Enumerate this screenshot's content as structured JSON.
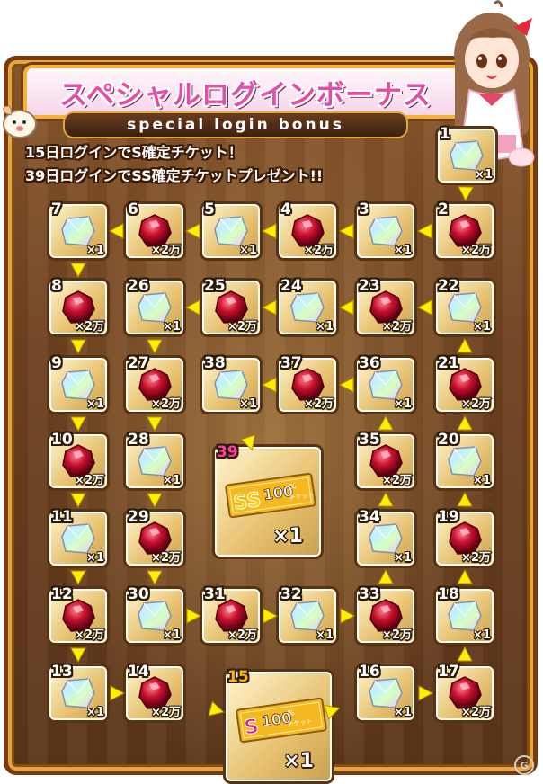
{
  "title": "スペシャルログインボーナス",
  "subtitle": "special login bonus",
  "description_line1": "15日ログインでS確定チケット！",
  "description_line2": "39日ログインでSS確定チケットプレゼント!!",
  "tiles": [
    {
      "day": "1",
      "reward": "crystal",
      "qty": "×1"
    },
    {
      "day": "2",
      "reward": "ruby",
      "qty": "×2万"
    },
    {
      "day": "3",
      "reward": "crystal",
      "qty": "×1"
    },
    {
      "day": "4",
      "reward": "ruby",
      "qty": "×2万"
    },
    {
      "day": "5",
      "reward": "crystal",
      "qty": "×1"
    },
    {
      "day": "6",
      "reward": "ruby",
      "qty": "×2万"
    },
    {
      "day": "7",
      "reward": "crystal",
      "qty": "×1"
    },
    {
      "day": "8",
      "reward": "ruby",
      "qty": "×2万"
    },
    {
      "day": "9",
      "reward": "crystal",
      "qty": "×1"
    },
    {
      "day": "10",
      "reward": "ruby",
      "qty": "×2万"
    },
    {
      "day": "11",
      "reward": "crystal",
      "qty": "×1"
    },
    {
      "day": "12",
      "reward": "ruby",
      "qty": "×2万"
    },
    {
      "day": "13",
      "reward": "crystal",
      "qty": "×1"
    },
    {
      "day": "14",
      "reward": "ruby",
      "qty": "×2万"
    },
    {
      "day": "15",
      "reward": "s-ticket",
      "qty": "×1"
    },
    {
      "day": "16",
      "reward": "crystal",
      "qty": "×1"
    },
    {
      "day": "17",
      "reward": "ruby",
      "qty": "×2万"
    },
    {
      "day": "18",
      "reward": "crystal",
      "qty": "×1"
    },
    {
      "day": "19",
      "reward": "ruby",
      "qty": "×2万"
    },
    {
      "day": "20",
      "reward": "crystal",
      "qty": "×1"
    },
    {
      "day": "21",
      "reward": "ruby",
      "qty": "×2万"
    },
    {
      "day": "22",
      "reward": "crystal",
      "qty": "×1"
    },
    {
      "day": "23",
      "reward": "ruby",
      "qty": "×2万"
    },
    {
      "day": "24",
      "reward": "crystal",
      "qty": "×1"
    },
    {
      "day": "25",
      "reward": "ruby",
      "qty": "×2万"
    },
    {
      "day": "26",
      "reward": "crystal",
      "qty": "×1"
    },
    {
      "day": "27",
      "reward": "ruby",
      "qty": "×2万"
    },
    {
      "day": "28",
      "reward": "crystal",
      "qty": "×1"
    },
    {
      "day": "29",
      "reward": "ruby",
      "qty": "×2万"
    },
    {
      "day": "30",
      "reward": "crystal",
      "qty": "×1"
    },
    {
      "day": "31",
      "reward": "ruby",
      "qty": "×2万"
    },
    {
      "day": "32",
      "reward": "crystal",
      "qty": "×1"
    },
    {
      "day": "33",
      "reward": "ruby",
      "qty": "×2万"
    },
    {
      "day": "34",
      "reward": "crystal",
      "qty": "×1"
    },
    {
      "day": "35",
      "reward": "ruby",
      "qty": "×2万"
    },
    {
      "day": "36",
      "reward": "crystal",
      "qty": "×1"
    },
    {
      "day": "37",
      "reward": "ruby",
      "qty": "×2万"
    },
    {
      "day": "38",
      "reward": "crystal",
      "qty": "×1"
    },
    {
      "day": "39",
      "reward": "ss-ticket",
      "qty": "×1"
    }
  ],
  "ticket_s": {
    "grade": "S",
    "percent": "100",
    "unit": "%",
    "label": "チケット"
  },
  "ticket_ss": {
    "grade": "SS",
    "percent": "100",
    "unit": "%",
    "label": "チケット"
  },
  "colors": {
    "ruby": "#c8102e",
    "crystal": "#b8e0ff",
    "arrow": "#ffee00",
    "frame": "#7a3a10",
    "title": "#e54ca8"
  },
  "watermark": "G"
}
